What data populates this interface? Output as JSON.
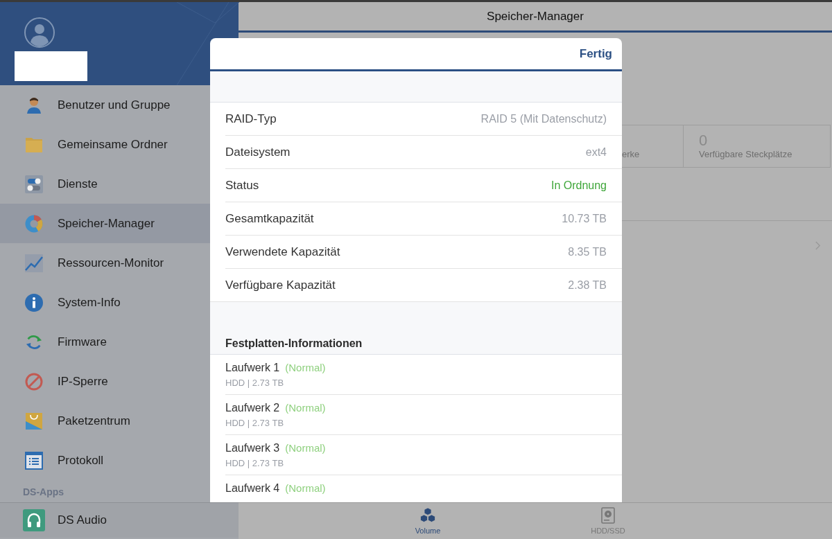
{
  "sidebar": {
    "items": [
      {
        "label": "Benutzer und Gruppe",
        "selected": false
      },
      {
        "label": "Gemeinsame Ordner",
        "selected": false
      },
      {
        "label": "Dienste",
        "selected": false
      },
      {
        "label": "Speicher-Manager",
        "selected": true
      },
      {
        "label": "Ressourcen-Monitor",
        "selected": false
      },
      {
        "label": "System-Info",
        "selected": false
      },
      {
        "label": "Firmware",
        "selected": false
      },
      {
        "label": "IP-Sperre",
        "selected": false
      },
      {
        "label": "Paketzentrum",
        "selected": false
      },
      {
        "label": "Protokoll",
        "selected": false
      }
    ],
    "section_label": "DS-Apps",
    "apps": [
      {
        "label": "DS Audio"
      }
    ]
  },
  "main": {
    "title": "Speicher-Manager",
    "tiles": [
      {
        "label": "erke"
      },
      {
        "value": "0",
        "label": "Verfügbare Steckplätze"
      }
    ],
    "tabs": [
      {
        "label": "Volume",
        "selected": true
      },
      {
        "label": "HDD/SSD",
        "selected": false
      }
    ]
  },
  "dialog": {
    "done_button": "Fertig",
    "properties": [
      {
        "label": "RAID-Typ",
        "value": "RAID 5 (Mit Datenschutz)",
        "kind": "plain"
      },
      {
        "label": "Dateisystem",
        "value": "ext4",
        "kind": "plain"
      },
      {
        "label": "Status",
        "value": "In Ordnung",
        "kind": "good"
      },
      {
        "label": "Gesamtkapazität",
        "value": "10.73 TB",
        "kind": "plain"
      },
      {
        "label": "Verwendete Kapazität",
        "value": "8.35 TB",
        "kind": "plain"
      },
      {
        "label": "Verfügbare Kapazität",
        "value": "2.38 TB",
        "kind": "plain"
      }
    ],
    "disks_heading": "Festplatten-Informationen",
    "disks": [
      {
        "name": "Laufwerk 1",
        "status": "(Normal)",
        "detail": "HDD | 2.73 TB"
      },
      {
        "name": "Laufwerk 2",
        "status": "(Normal)",
        "detail": "HDD | 2.73 TB"
      },
      {
        "name": "Laufwerk 3",
        "status": "(Normal)",
        "detail": "HDD | 2.73 TB"
      },
      {
        "name": "Laufwerk 4",
        "status": "(Normal)"
      }
    ]
  }
}
